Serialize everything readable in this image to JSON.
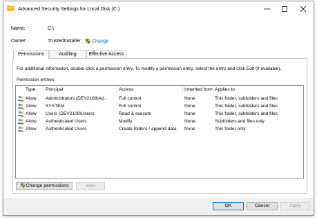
{
  "window": {
    "title": "Advanced Security Settings for Local Disk (C:)"
  },
  "header": {
    "name_label": "Name:",
    "name_value": "C:\\",
    "owner_label": "Owner:",
    "owner_value": "TrustedInstaller",
    "change_link": "Change"
  },
  "tabs": [
    "Permissions",
    "Auditing",
    "Effective Access"
  ],
  "permissions": {
    "info": "For additional information, double-click a permission entry. To modify a permission entry, select the entry and click Edit (if available).",
    "entries_label": "Permission entries:",
    "columns": [
      "Type",
      "Principal",
      "Access",
      "Inherited from",
      "Applies to"
    ],
    "rows": [
      {
        "type": "Allow",
        "principal": "Administrators (DEV2108\\Ad...",
        "access": "Full control",
        "inherited": "None",
        "applies": "This folder, subfolders and files"
      },
      {
        "type": "Allow",
        "principal": "SYSTEM",
        "access": "Full control",
        "inherited": "None",
        "applies": "This folder, subfolders and files"
      },
      {
        "type": "Allow",
        "principal": "Users (DEV2108\\Users)",
        "access": "Read & execute",
        "inherited": "None",
        "applies": "This folder, subfolders and files"
      },
      {
        "type": "Allow",
        "principal": "Authenticated Users",
        "access": "Modify",
        "inherited": "None",
        "applies": "Subfolders and files only"
      },
      {
        "type": "Allow",
        "principal": "Authenticated Users",
        "access": "Create folders / append data",
        "inherited": "None",
        "applies": "This folder only"
      }
    ],
    "change_permissions_button": "Change permissions",
    "view_button": "View"
  },
  "footer": {
    "ok": "OK",
    "cancel": "Cancel",
    "apply": "Apply"
  },
  "colors": {
    "link": "#0066cc",
    "accent": "#0078d7",
    "folder": "#f3c24f"
  },
  "icons": [
    "folder-icon",
    "minimize-icon",
    "maximize-icon",
    "close-icon",
    "shield-icon",
    "user-group-icon"
  ]
}
